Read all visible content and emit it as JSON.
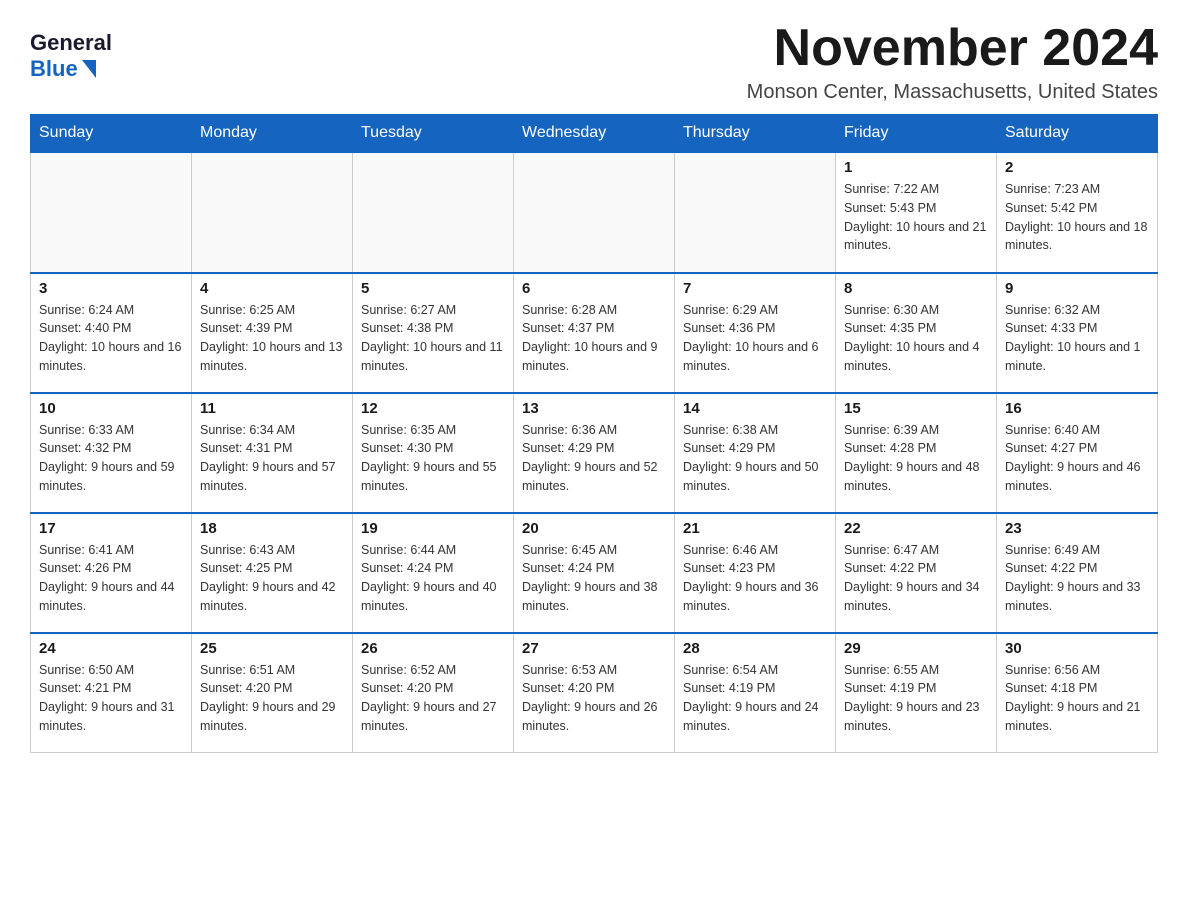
{
  "logo": {
    "general": "General",
    "blue": "Blue"
  },
  "header": {
    "month_year": "November 2024",
    "location": "Monson Center, Massachusetts, United States"
  },
  "days_of_week": [
    "Sunday",
    "Monday",
    "Tuesday",
    "Wednesday",
    "Thursday",
    "Friday",
    "Saturday"
  ],
  "weeks": [
    [
      {
        "day": "",
        "sunrise": "",
        "sunset": "",
        "daylight": ""
      },
      {
        "day": "",
        "sunrise": "",
        "sunset": "",
        "daylight": ""
      },
      {
        "day": "",
        "sunrise": "",
        "sunset": "",
        "daylight": ""
      },
      {
        "day": "",
        "sunrise": "",
        "sunset": "",
        "daylight": ""
      },
      {
        "day": "",
        "sunrise": "",
        "sunset": "",
        "daylight": ""
      },
      {
        "day": "1",
        "sunrise": "Sunrise: 7:22 AM",
        "sunset": "Sunset: 5:43 PM",
        "daylight": "Daylight: 10 hours and 21 minutes."
      },
      {
        "day": "2",
        "sunrise": "Sunrise: 7:23 AM",
        "sunset": "Sunset: 5:42 PM",
        "daylight": "Daylight: 10 hours and 18 minutes."
      }
    ],
    [
      {
        "day": "3",
        "sunrise": "Sunrise: 6:24 AM",
        "sunset": "Sunset: 4:40 PM",
        "daylight": "Daylight: 10 hours and 16 minutes."
      },
      {
        "day": "4",
        "sunrise": "Sunrise: 6:25 AM",
        "sunset": "Sunset: 4:39 PM",
        "daylight": "Daylight: 10 hours and 13 minutes."
      },
      {
        "day": "5",
        "sunrise": "Sunrise: 6:27 AM",
        "sunset": "Sunset: 4:38 PM",
        "daylight": "Daylight: 10 hours and 11 minutes."
      },
      {
        "day": "6",
        "sunrise": "Sunrise: 6:28 AM",
        "sunset": "Sunset: 4:37 PM",
        "daylight": "Daylight: 10 hours and 9 minutes."
      },
      {
        "day": "7",
        "sunrise": "Sunrise: 6:29 AM",
        "sunset": "Sunset: 4:36 PM",
        "daylight": "Daylight: 10 hours and 6 minutes."
      },
      {
        "day": "8",
        "sunrise": "Sunrise: 6:30 AM",
        "sunset": "Sunset: 4:35 PM",
        "daylight": "Daylight: 10 hours and 4 minutes."
      },
      {
        "day": "9",
        "sunrise": "Sunrise: 6:32 AM",
        "sunset": "Sunset: 4:33 PM",
        "daylight": "Daylight: 10 hours and 1 minute."
      }
    ],
    [
      {
        "day": "10",
        "sunrise": "Sunrise: 6:33 AM",
        "sunset": "Sunset: 4:32 PM",
        "daylight": "Daylight: 9 hours and 59 minutes."
      },
      {
        "day": "11",
        "sunrise": "Sunrise: 6:34 AM",
        "sunset": "Sunset: 4:31 PM",
        "daylight": "Daylight: 9 hours and 57 minutes."
      },
      {
        "day": "12",
        "sunrise": "Sunrise: 6:35 AM",
        "sunset": "Sunset: 4:30 PM",
        "daylight": "Daylight: 9 hours and 55 minutes."
      },
      {
        "day": "13",
        "sunrise": "Sunrise: 6:36 AM",
        "sunset": "Sunset: 4:29 PM",
        "daylight": "Daylight: 9 hours and 52 minutes."
      },
      {
        "day": "14",
        "sunrise": "Sunrise: 6:38 AM",
        "sunset": "Sunset: 4:29 PM",
        "daylight": "Daylight: 9 hours and 50 minutes."
      },
      {
        "day": "15",
        "sunrise": "Sunrise: 6:39 AM",
        "sunset": "Sunset: 4:28 PM",
        "daylight": "Daylight: 9 hours and 48 minutes."
      },
      {
        "day": "16",
        "sunrise": "Sunrise: 6:40 AM",
        "sunset": "Sunset: 4:27 PM",
        "daylight": "Daylight: 9 hours and 46 minutes."
      }
    ],
    [
      {
        "day": "17",
        "sunrise": "Sunrise: 6:41 AM",
        "sunset": "Sunset: 4:26 PM",
        "daylight": "Daylight: 9 hours and 44 minutes."
      },
      {
        "day": "18",
        "sunrise": "Sunrise: 6:43 AM",
        "sunset": "Sunset: 4:25 PM",
        "daylight": "Daylight: 9 hours and 42 minutes."
      },
      {
        "day": "19",
        "sunrise": "Sunrise: 6:44 AM",
        "sunset": "Sunset: 4:24 PM",
        "daylight": "Daylight: 9 hours and 40 minutes."
      },
      {
        "day": "20",
        "sunrise": "Sunrise: 6:45 AM",
        "sunset": "Sunset: 4:24 PM",
        "daylight": "Daylight: 9 hours and 38 minutes."
      },
      {
        "day": "21",
        "sunrise": "Sunrise: 6:46 AM",
        "sunset": "Sunset: 4:23 PM",
        "daylight": "Daylight: 9 hours and 36 minutes."
      },
      {
        "day": "22",
        "sunrise": "Sunrise: 6:47 AM",
        "sunset": "Sunset: 4:22 PM",
        "daylight": "Daylight: 9 hours and 34 minutes."
      },
      {
        "day": "23",
        "sunrise": "Sunrise: 6:49 AM",
        "sunset": "Sunset: 4:22 PM",
        "daylight": "Daylight: 9 hours and 33 minutes."
      }
    ],
    [
      {
        "day": "24",
        "sunrise": "Sunrise: 6:50 AM",
        "sunset": "Sunset: 4:21 PM",
        "daylight": "Daylight: 9 hours and 31 minutes."
      },
      {
        "day": "25",
        "sunrise": "Sunrise: 6:51 AM",
        "sunset": "Sunset: 4:20 PM",
        "daylight": "Daylight: 9 hours and 29 minutes."
      },
      {
        "day": "26",
        "sunrise": "Sunrise: 6:52 AM",
        "sunset": "Sunset: 4:20 PM",
        "daylight": "Daylight: 9 hours and 27 minutes."
      },
      {
        "day": "27",
        "sunrise": "Sunrise: 6:53 AM",
        "sunset": "Sunset: 4:20 PM",
        "daylight": "Daylight: 9 hours and 26 minutes."
      },
      {
        "day": "28",
        "sunrise": "Sunrise: 6:54 AM",
        "sunset": "Sunset: 4:19 PM",
        "daylight": "Daylight: 9 hours and 24 minutes."
      },
      {
        "day": "29",
        "sunrise": "Sunrise: 6:55 AM",
        "sunset": "Sunset: 4:19 PM",
        "daylight": "Daylight: 9 hours and 23 minutes."
      },
      {
        "day": "30",
        "sunrise": "Sunrise: 6:56 AM",
        "sunset": "Sunset: 4:18 PM",
        "daylight": "Daylight: 9 hours and 21 minutes."
      }
    ]
  ]
}
